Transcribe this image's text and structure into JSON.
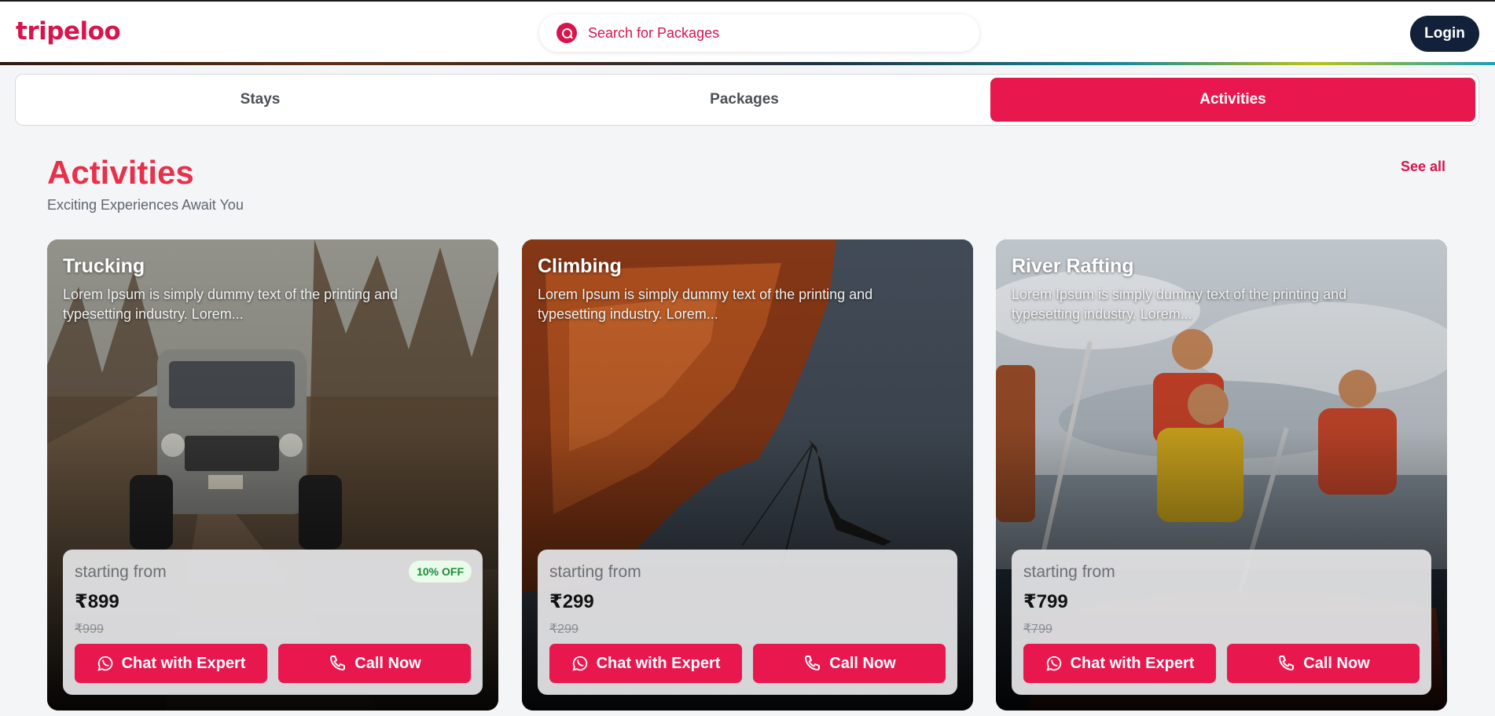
{
  "header": {
    "logo": "tripeloo",
    "search_placeholder": "Search for Packages",
    "login_label": "Login"
  },
  "tabs": [
    {
      "label": "Stays",
      "active": false
    },
    {
      "label": "Packages",
      "active": false
    },
    {
      "label": "Activities",
      "active": true
    }
  ],
  "section": {
    "title": "Activities",
    "subtitle": "Exciting Experiences Await You",
    "see_all": "See all"
  },
  "cards": [
    {
      "title": "Trucking",
      "description": "Lorem Ipsum is simply dummy text of the printing and typesetting industry. Lorem...",
      "starting_from": "starting from",
      "price": "₹899",
      "old_price": "₹999",
      "badge": "10% OFF",
      "chat_label": "Chat with Expert",
      "call_label": "Call Now"
    },
    {
      "title": "Climbing",
      "description": "Lorem Ipsum is simply dummy text of the printing and typesetting industry. Lorem...",
      "starting_from": "starting from",
      "price": "₹299",
      "old_price": "₹299",
      "chat_label": "Chat with Expert",
      "call_label": "Call Now"
    },
    {
      "title": "River Rafting",
      "description": "Lorem Ipsum is simply dummy text of the printing and typesetting industry. Lorem...",
      "starting_from": "starting from",
      "price": "₹799",
      "old_price": "₹799",
      "chat_label": "Chat with Expert",
      "call_label": "Call Now"
    }
  ],
  "colors": {
    "brand": "#d9144d",
    "button": "#e8184f",
    "title": "#e8304a",
    "login_bg": "#13203a",
    "badge_text": "#1c8b3c"
  },
  "icons": {
    "search": "search-icon",
    "chat": "whatsapp-icon",
    "call": "phone-icon"
  }
}
